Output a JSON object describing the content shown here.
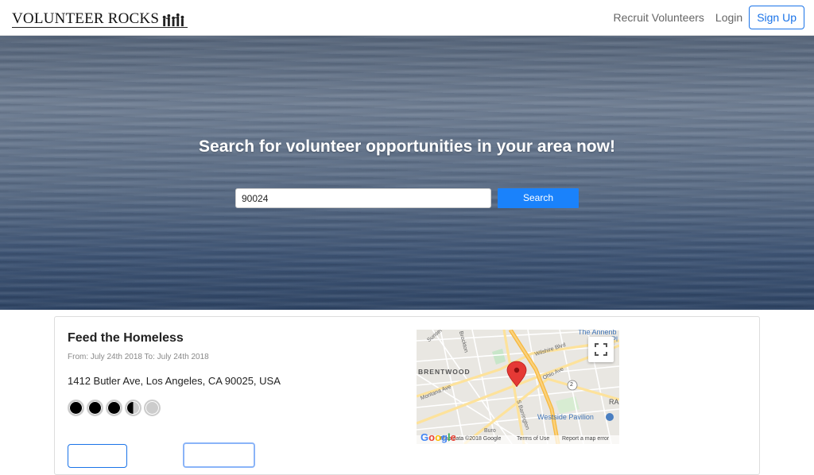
{
  "navbar": {
    "brand": "VOLUNTEER ROCKS",
    "links": [
      "Recruit Volunteers",
      "Login"
    ],
    "signup_label": "Sign Up"
  },
  "hero": {
    "title": "Search for volunteer opportunities in your area now!",
    "search_value": "90024",
    "search_button": "Search"
  },
  "result": {
    "title": "Feed the Homeless",
    "dates": "From: July 24th 2018 To: July 24th 2018",
    "address": "1412 Butler Ave, Los Angeles, CA 90025, USA",
    "rating": 3.5,
    "rating_max": 5
  },
  "map": {
    "labels": {
      "wilshire": "Wilshire Blvd",
      "ohio": "Ohio Ave",
      "montana": "Montana Ave",
      "barrington": "S Barrington",
      "sunset": "Sunset",
      "brockton": "Brockton",
      "annenberg": "The Annenb",
      "pl": "Pl",
      "ra": "RA",
      "highway": "2",
      "buro": "Buro"
    },
    "place_brentwood": "BRENTWOOD",
    "place_pavilion": "Westside Pavilion",
    "footer": {
      "data": "Map data ©2018 Google",
      "terms": "Terms of Use",
      "report": "Report a map error"
    },
    "google": "Google"
  },
  "colors": {
    "accent": "#1a82fb",
    "marker": "#e53935"
  }
}
